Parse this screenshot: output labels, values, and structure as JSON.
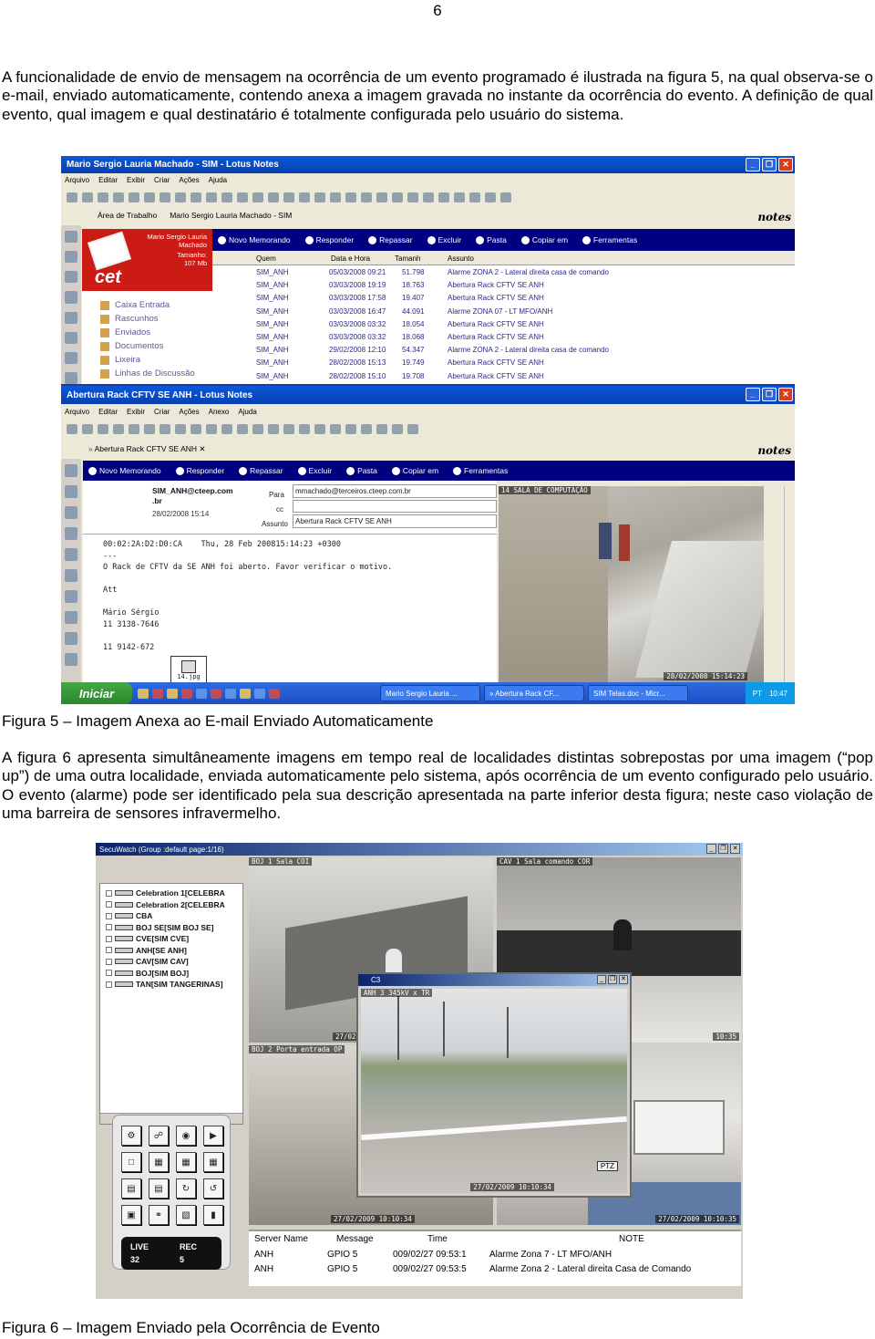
{
  "page_number": "6",
  "paragraph1": "A funcionalidade de envio de mensagem na ocorrência de um evento programado é ilustrada na figura 5, na qual observa-se o e-mail, enviado automaticamente, contendo anexa a imagem gravada no instante da ocorrência do evento. A definição de qual evento, qual imagem e qual destinatário é totalmente configurada pelo usuário do sistema.",
  "figure5": {
    "caption": "Figura 5 – Imagem Anexa ao E-mail Enviado Automaticamente",
    "main_window": {
      "title": "Mario Sergio Lauria Machado - SIM - Lotus Notes",
      "menu": [
        "Arquivo",
        "Editar",
        "Exibir",
        "Criar",
        "Ações",
        "Ajuda"
      ],
      "tab_workspace": "Área de Trabalho",
      "tab_mailbox": "Mario Sergio Lauria Machado - SIM",
      "logo": "notes",
      "nav": [
        "Novo Memorando",
        "Responder",
        "Repassar",
        "Excluir",
        "Pasta",
        "Copiar em",
        "Ferramentas"
      ],
      "profile_name": "Mario Sergio Lauria Machado",
      "profile_size_label": "Tamanho:",
      "profile_size": "107 Mb",
      "folders": [
        "Caixa Entrada",
        "Rascunhos",
        "Enviados",
        "Documentos",
        "Lixeira",
        "Linhas de Discussão"
      ],
      "columns": [
        "Quem",
        "Data e Hora",
        "Tamanh",
        "Assunto"
      ],
      "rows": [
        {
          "who": "SIM_ANH",
          "date": "05/03/2008 09:21",
          "size": "51.798",
          "subject": "Alarme ZONA 2 - Lateral direita casa de comando"
        },
        {
          "who": "SIM_ANH",
          "date": "03/03/2008 19:19",
          "size": "18.763",
          "subject": "Abertura Rack CFTV SE ANH"
        },
        {
          "who": "SIM_ANH",
          "date": "03/03/2008 17:58",
          "size": "19.407",
          "subject": "Abertura Rack CFTV SE ANH"
        },
        {
          "who": "SIM_ANH",
          "date": "03/03/2008 16:47",
          "size": "44.091",
          "subject": "Alarme ZONA 07 - LT MFO/ANH"
        },
        {
          "who": "SIM_ANH",
          "date": "03/03/2008 03:32",
          "size": "18.054",
          "subject": "Abertura Rack CFTV SE ANH"
        },
        {
          "who": "SIM_ANH",
          "date": "03/03/2008 03:32",
          "size": "18.068",
          "subject": "Abertura Rack CFTV SE ANH"
        },
        {
          "who": "SIM_ANH",
          "date": "29/02/2008 12:10",
          "size": "54.347",
          "subject": "Alarme ZONA 2 - Lateral direita casa de comando"
        },
        {
          "who": "SIM_ANH",
          "date": "28/02/2008 15:13",
          "size": "19.749",
          "subject": "Abertura Rack CFTV SE ANH"
        },
        {
          "who": "SIM_ANH",
          "date": "28/02/2008 15:10",
          "size": "19.708",
          "subject": "Abertura Rack CFTV SE ANH"
        }
      ]
    },
    "memo_window": {
      "title": "Abertura Rack CFTV SE ANH - Lotus Notes",
      "menu": [
        "Arquivo",
        "Editar",
        "Exibir",
        "Criar",
        "Ações",
        "Anexo",
        "Ajuda"
      ],
      "tab": "Abertura Rack CFTV SE ANH",
      "logo": "notes",
      "nav": [
        "Novo Memorando",
        "Responder",
        "Repassar",
        "Excluir",
        "Pasta",
        "Copiar em",
        "Ferramentas"
      ],
      "sender": "SIM_ANH@cteep.com",
      "sender2": ".br",
      "sent_date": "28/02/2008 15:14",
      "label_to": "Para",
      "to": "mmachado@terceiros.cteep.com.br",
      "label_cc": "cc",
      "label_subject": "Assunto",
      "subject": "Abertura Rack CFTV SE ANH",
      "body": [
        "00:02:2A:D2:D0:CA    Thu, 28 Feb 200815:14:23 +0300",
        "---",
        "O Rack de CFTV da SE ANH foi aberto. Favor verificar o motivo.",
        "",
        "Att",
        "",
        "Mário Sérgio",
        "11 3138-7646",
        "",
        "11 9142-672"
      ],
      "attachment_name": "14.jpg",
      "camera_label": "14 SALA DE COMPUTAÇÃO",
      "camera_time": "28/02/2008 15:14:23"
    },
    "taskbar": {
      "start": "Iniciar",
      "tasks": [
        "Mario Sergio Lauria ...",
        "» Abertura Rack CF...",
        "SIM Telas.doc - Micr..."
      ],
      "lang": "PT",
      "clock": "10:47"
    }
  },
  "paragraph2": "A figura 6 apresenta simultâneamente imagens em tempo real de localidades distintas sobrepostas por uma imagem (“pop up”) de uma outra localidade, enviada automaticamente pelo sistema, após ocorrência de um evento configurado pelo usuário. O evento (alarme) pode ser identificado pela sua descrição apresentada na parte inferior desta figura; neste caso violação de uma barreira de sensores infravermelho.",
  "figure6": {
    "caption": "Figura 6 – Imagem Enviado pela Ocorrência de Evento",
    "title": "SecuWatch (Group :default  page:1/16)",
    "tree": [
      "Celebration 1[CELEBRA",
      "Celebration 2[CELEBRA",
      "CBA",
      "BOJ SE[SIM BOJ SE]",
      "CVE[SIM CVE]",
      "ANH[SE ANH]",
      "CAV[SIM CAV]",
      "BOJ[SIM BOJ]",
      "TAN[SIM TANGERINAS]"
    ],
    "cam1_label": "BOJ 1 Sala COI",
    "cam1_time": "27/02",
    "cam2_label": "CAV 1 Sala comando COR",
    "cam2_time": "10:35",
    "cam3_label": "BOJ 2 Porta entrada OP",
    "cam3_time": "27/02/2009 10:10:34",
    "cam4_time": "27/02/2009 10:10:35",
    "popup_title": "C3",
    "popup_label": "ANH 3 345kV x TR",
    "popup_time": "27/02/2009 10:10:34",
    "popup_ptz": "PTZ",
    "live_label": "LIVE",
    "live_value": "32",
    "rec_label": "REC",
    "rec_value": "5",
    "event_columns": [
      "Server Name",
      "Message",
      "Time",
      "NOTE"
    ],
    "events": [
      {
        "server": "ANH",
        "message": "GPIO 5",
        "time": "009/02/27 09:53:1",
        "note": "Alarme Zona 7 - LT MFO/ANH"
      },
      {
        "server": "ANH",
        "message": "GPIO 5",
        "time": "009/02/27 09:53:5",
        "note": "Alarme Zona 2 - Lateral direita Casa de Comando"
      }
    ]
  }
}
